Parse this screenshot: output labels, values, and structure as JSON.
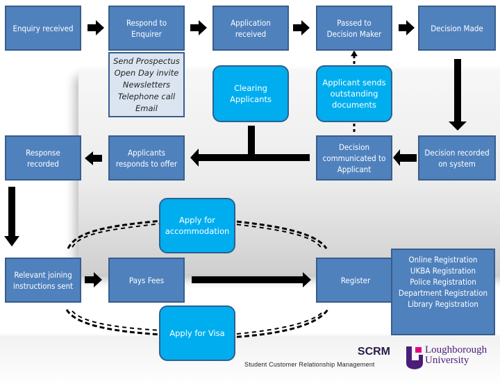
{
  "nodes": {
    "enquiry_received": "Enquiry received",
    "respond_to_enquirer": "Respond to\nEnquirer",
    "enquirer_actions": "Send Prospectus\nOpen Day invite\nNewsletters\nTelephone call\nEmail",
    "application_received": "Application\nreceived",
    "passed_to_decision_maker": "Passed to\nDecision Maker",
    "decision_made": "Decision Made",
    "clearing_applicants": "Clearing\nApplicants",
    "applicant_sends_documents": "Applicant sends\noutstanding\ndocuments",
    "response_recorded": "Response\nrecorded",
    "applicants_responds": "Applicants\nresponds to offer",
    "decision_communicated": "Decision\ncommunicated to\nApplicant",
    "decision_recorded": "Decision recorded\non system",
    "apply_accommodation": "Apply for\naccommodation",
    "joining_instructions": "Relevant joining\ninstructions sent",
    "pays_fees": "Pays Fees",
    "register": "Register",
    "registration_types": "Online Registration\nUKBA Registration\nPolice Registration\nDepartment Registration\nLibrary Registration",
    "apply_visa": "Apply for Visa"
  },
  "footer": {
    "title": "SCRM",
    "subtitle": "Student Customer Relationship Management",
    "university_line1": "Loughborough",
    "university_line2": "University"
  },
  "colors": {
    "process_box": "#4f81bd",
    "rounded_box": "#00aeef",
    "note_box": "#dbe5f1",
    "brand_purple": "#4b1d7a",
    "brand_pink": "#e6007e"
  }
}
